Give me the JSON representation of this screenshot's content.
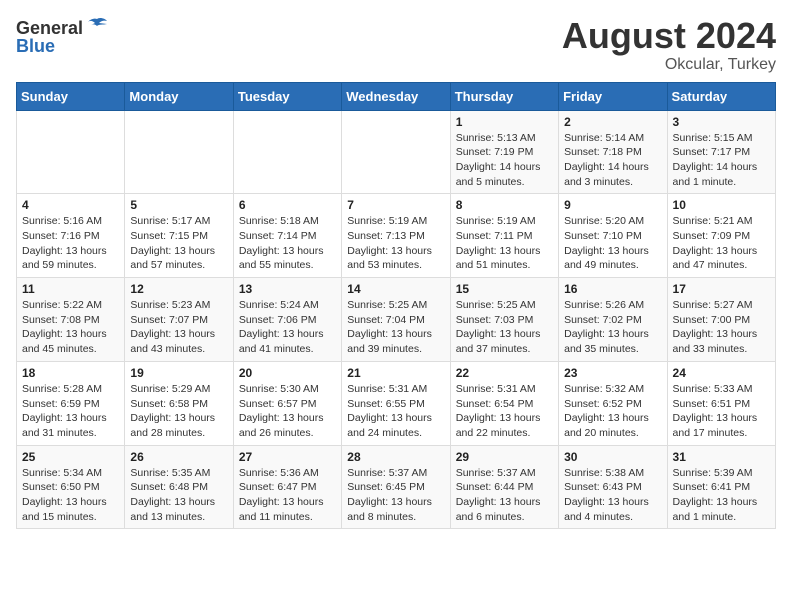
{
  "header": {
    "logo_general": "General",
    "logo_blue": "Blue",
    "month_year": "August 2024",
    "location": "Okcular, Turkey"
  },
  "days_of_week": [
    "Sunday",
    "Monday",
    "Tuesday",
    "Wednesday",
    "Thursday",
    "Friday",
    "Saturday"
  ],
  "weeks": [
    [
      {
        "day": "",
        "info": ""
      },
      {
        "day": "",
        "info": ""
      },
      {
        "day": "",
        "info": ""
      },
      {
        "day": "",
        "info": ""
      },
      {
        "day": "1",
        "info": "Sunrise: 5:13 AM\nSunset: 7:19 PM\nDaylight: 14 hours\nand 5 minutes."
      },
      {
        "day": "2",
        "info": "Sunrise: 5:14 AM\nSunset: 7:18 PM\nDaylight: 14 hours\nand 3 minutes."
      },
      {
        "day": "3",
        "info": "Sunrise: 5:15 AM\nSunset: 7:17 PM\nDaylight: 14 hours\nand 1 minute."
      }
    ],
    [
      {
        "day": "4",
        "info": "Sunrise: 5:16 AM\nSunset: 7:16 PM\nDaylight: 13 hours\nand 59 minutes."
      },
      {
        "day": "5",
        "info": "Sunrise: 5:17 AM\nSunset: 7:15 PM\nDaylight: 13 hours\nand 57 minutes."
      },
      {
        "day": "6",
        "info": "Sunrise: 5:18 AM\nSunset: 7:14 PM\nDaylight: 13 hours\nand 55 minutes."
      },
      {
        "day": "7",
        "info": "Sunrise: 5:19 AM\nSunset: 7:13 PM\nDaylight: 13 hours\nand 53 minutes."
      },
      {
        "day": "8",
        "info": "Sunrise: 5:19 AM\nSunset: 7:11 PM\nDaylight: 13 hours\nand 51 minutes."
      },
      {
        "day": "9",
        "info": "Sunrise: 5:20 AM\nSunset: 7:10 PM\nDaylight: 13 hours\nand 49 minutes."
      },
      {
        "day": "10",
        "info": "Sunrise: 5:21 AM\nSunset: 7:09 PM\nDaylight: 13 hours\nand 47 minutes."
      }
    ],
    [
      {
        "day": "11",
        "info": "Sunrise: 5:22 AM\nSunset: 7:08 PM\nDaylight: 13 hours\nand 45 minutes."
      },
      {
        "day": "12",
        "info": "Sunrise: 5:23 AM\nSunset: 7:07 PM\nDaylight: 13 hours\nand 43 minutes."
      },
      {
        "day": "13",
        "info": "Sunrise: 5:24 AM\nSunset: 7:06 PM\nDaylight: 13 hours\nand 41 minutes."
      },
      {
        "day": "14",
        "info": "Sunrise: 5:25 AM\nSunset: 7:04 PM\nDaylight: 13 hours\nand 39 minutes."
      },
      {
        "day": "15",
        "info": "Sunrise: 5:25 AM\nSunset: 7:03 PM\nDaylight: 13 hours\nand 37 minutes."
      },
      {
        "day": "16",
        "info": "Sunrise: 5:26 AM\nSunset: 7:02 PM\nDaylight: 13 hours\nand 35 minutes."
      },
      {
        "day": "17",
        "info": "Sunrise: 5:27 AM\nSunset: 7:00 PM\nDaylight: 13 hours\nand 33 minutes."
      }
    ],
    [
      {
        "day": "18",
        "info": "Sunrise: 5:28 AM\nSunset: 6:59 PM\nDaylight: 13 hours\nand 31 minutes."
      },
      {
        "day": "19",
        "info": "Sunrise: 5:29 AM\nSunset: 6:58 PM\nDaylight: 13 hours\nand 28 minutes."
      },
      {
        "day": "20",
        "info": "Sunrise: 5:30 AM\nSunset: 6:57 PM\nDaylight: 13 hours\nand 26 minutes."
      },
      {
        "day": "21",
        "info": "Sunrise: 5:31 AM\nSunset: 6:55 PM\nDaylight: 13 hours\nand 24 minutes."
      },
      {
        "day": "22",
        "info": "Sunrise: 5:31 AM\nSunset: 6:54 PM\nDaylight: 13 hours\nand 22 minutes."
      },
      {
        "day": "23",
        "info": "Sunrise: 5:32 AM\nSunset: 6:52 PM\nDaylight: 13 hours\nand 20 minutes."
      },
      {
        "day": "24",
        "info": "Sunrise: 5:33 AM\nSunset: 6:51 PM\nDaylight: 13 hours\nand 17 minutes."
      }
    ],
    [
      {
        "day": "25",
        "info": "Sunrise: 5:34 AM\nSunset: 6:50 PM\nDaylight: 13 hours\nand 15 minutes."
      },
      {
        "day": "26",
        "info": "Sunrise: 5:35 AM\nSunset: 6:48 PM\nDaylight: 13 hours\nand 13 minutes."
      },
      {
        "day": "27",
        "info": "Sunrise: 5:36 AM\nSunset: 6:47 PM\nDaylight: 13 hours\nand 11 minutes."
      },
      {
        "day": "28",
        "info": "Sunrise: 5:37 AM\nSunset: 6:45 PM\nDaylight: 13 hours\nand 8 minutes."
      },
      {
        "day": "29",
        "info": "Sunrise: 5:37 AM\nSunset: 6:44 PM\nDaylight: 13 hours\nand 6 minutes."
      },
      {
        "day": "30",
        "info": "Sunrise: 5:38 AM\nSunset: 6:43 PM\nDaylight: 13 hours\nand 4 minutes."
      },
      {
        "day": "31",
        "info": "Sunrise: 5:39 AM\nSunset: 6:41 PM\nDaylight: 13 hours\nand 1 minute."
      }
    ]
  ]
}
